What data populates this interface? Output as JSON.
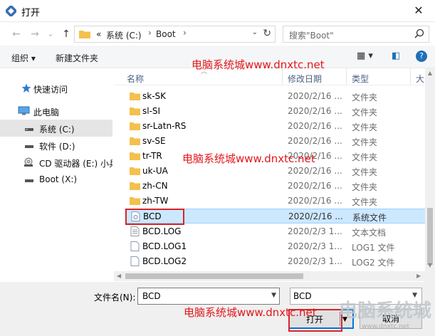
{
  "window": {
    "title": "打开",
    "close_glyph": "✕"
  },
  "nav": {
    "back_glyph": "←",
    "forward_glyph": "→",
    "recent_glyph": "⌄",
    "up_glyph": "↑",
    "breadcrumb": [
      "«",
      "系统 (C:)",
      "Boot"
    ],
    "breadcrumb_sep": "›",
    "address_dropdown_glyph": "⌄",
    "refresh_glyph": "↻",
    "search_placeholder": "搜索\"Boot\""
  },
  "toolbar": {
    "organize": "组织 ▾",
    "new_folder": "新建文件夹",
    "view_glyph": "▦ ▾",
    "pane_glyph": "◧",
    "help_glyph": "?"
  },
  "sidebar": {
    "items": [
      {
        "label": "快速访问",
        "icon": "star-icon"
      },
      {
        "label": "此电脑",
        "icon": "computer-icon"
      },
      {
        "label": "系统 (C:)",
        "icon": "drive-icon",
        "selected": true
      },
      {
        "label": "软件 (D:)",
        "icon": "drive-icon"
      },
      {
        "label": "CD 驱动器 (E:) 小兵",
        "icon": "cd-drive-icon"
      },
      {
        "label": "Boot (X:)",
        "icon": "drive-icon"
      }
    ]
  },
  "columns": {
    "name": "名称",
    "date": "修改日期",
    "type": "类型",
    "size": "大"
  },
  "files": [
    {
      "name": "sk-SK",
      "date": "2020/2/16 ...",
      "type": "文件夹",
      "icon": "folder-icon"
    },
    {
      "name": "sl-SI",
      "date": "2020/2/16 ...",
      "type": "文件夹",
      "icon": "folder-icon"
    },
    {
      "name": "sr-Latn-RS",
      "date": "2020/2/16 ...",
      "type": "文件夹",
      "icon": "folder-icon"
    },
    {
      "name": "sv-SE",
      "date": "2020/2/16 ...",
      "type": "文件夹",
      "icon": "folder-icon"
    },
    {
      "name": "tr-TR",
      "date": "2020/2/16 ...",
      "type": "文件夹",
      "icon": "folder-icon"
    },
    {
      "name": "uk-UA",
      "date": "2020/2/16 ...",
      "type": "文件夹",
      "icon": "folder-icon"
    },
    {
      "name": "zh-CN",
      "date": "2020/2/16 ...",
      "type": "文件夹",
      "icon": "folder-icon"
    },
    {
      "name": "zh-TW",
      "date": "2020/2/16 ...",
      "type": "文件夹",
      "icon": "folder-icon"
    },
    {
      "name": "BCD",
      "date": "2020/2/16 ...",
      "type": "系统文件",
      "icon": "system-file-icon",
      "selected": true
    },
    {
      "name": "BCD.LOG",
      "date": "2020/2/3 1...",
      "type": "文本文档",
      "icon": "text-file-icon"
    },
    {
      "name": "BCD.LOG1",
      "date": "2020/2/3 1...",
      "type": "LOG1 文件",
      "icon": "file-icon"
    },
    {
      "name": "BCD.LOG2",
      "date": "2020/2/3 1...",
      "type": "LOG2 文件",
      "icon": "file-icon"
    }
  ],
  "bottom": {
    "filename_label": "文件名(N):",
    "filename_value": "BCD",
    "filetype_value": "BCD",
    "open_label": "打开",
    "cancel_label": "取消"
  },
  "watermarks": {
    "text_1": "电脑系统城www.dnxtc.net",
    "text_2": "电脑系统城www.dnxtc.net",
    "text_3": "电脑系统城www.dnxtc.net",
    "logo_text": "电脑系统城",
    "logo_sub": "www.dnxtc.net"
  },
  "colors": {
    "accent": "#0078d7",
    "selection": "#cce8ff",
    "folder": "#f4c04e",
    "highlight": "#d9232a",
    "watermark": "#e3171c"
  }
}
